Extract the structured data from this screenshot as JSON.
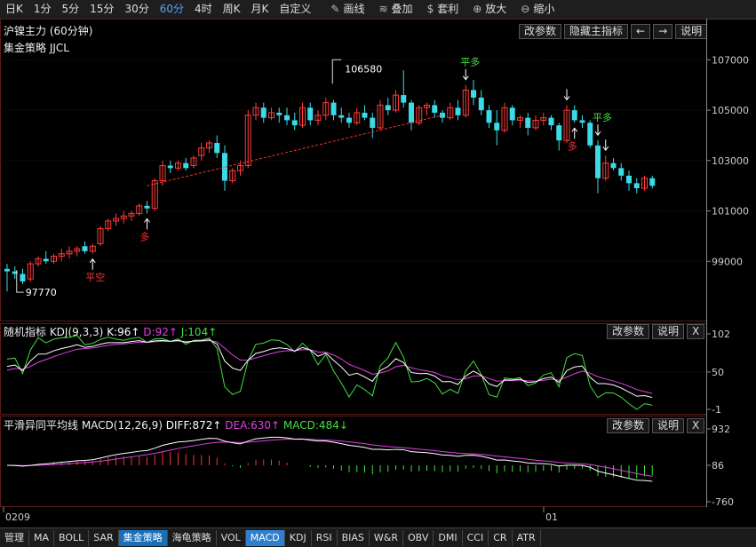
{
  "toolbar": {
    "timeframes": [
      "日K",
      "1分",
      "5分",
      "15分",
      "30分",
      "60分",
      "4时",
      "周K",
      "月K",
      "自定义"
    ],
    "active_timeframe": "60分",
    "tools": [
      {
        "label": "画线",
        "icon": "pencil-icon"
      },
      {
        "label": "叠加",
        "icon": "layers-icon"
      },
      {
        "label": "套利",
        "icon": "moneybag-icon"
      },
      {
        "label": "放大",
        "icon": "zoom-in-icon"
      },
      {
        "label": "缩小",
        "icon": "zoom-out-icon"
      }
    ]
  },
  "main_panel": {
    "title": "沪镍主力 (60分钟)",
    "strategy_label": "集金策略 JJCL",
    "buttons": {
      "params": "改参数",
      "hide": "隐藏主指标",
      "prev": "←",
      "next": "→",
      "help": "说明"
    },
    "price_axis": [
      "107000",
      "105000",
      "103000",
      "101000",
      "99000"
    ],
    "high_label": "106580",
    "low_label": "97770",
    "signals": [
      "平空",
      "多",
      "平多",
      "平多",
      "多"
    ]
  },
  "kdj_panel": {
    "title": "随机指标 KDJ(9,3,3)",
    "k": "K:96↑",
    "d": "D:92↑",
    "j": "J:104↑",
    "buttons": {
      "params": "改参数",
      "help": "说明",
      "close": "X"
    },
    "axis": [
      "102",
      "50",
      "-1"
    ],
    "colors": {
      "k": "#ffffff",
      "d": "#e040e0",
      "j": "#40e040"
    }
  },
  "macd_panel": {
    "title": "平滑异同平均线 MACD(12,26,9)",
    "diff": "DIFF:872↑",
    "dea": "DEA:630↑",
    "macd": "MACD:484↓",
    "buttons": {
      "params": "改参数",
      "help": "说明",
      "close": "X"
    },
    "axis": [
      "932",
      "86",
      "-760"
    ],
    "colors": {
      "diff": "#ffffff",
      "dea": "#e040e0",
      "macd": "#40e040"
    }
  },
  "date_axis": [
    "0209",
    "01"
  ],
  "bottom_tabs": [
    "管理",
    "MA",
    "BOLL",
    "SAR",
    "集金策略",
    "海龟策略",
    "VOL",
    "MACD",
    "KDJ",
    "RSI",
    "BIAS",
    "W&R",
    "OBV",
    "DMI",
    "CCI",
    "CR",
    "ATR"
  ],
  "selected_tabs": [
    "集金策略",
    "MACD"
  ],
  "chart_data": {
    "type": "candlestick",
    "y_range": [
      97000,
      108000
    ],
    "candles": [
      [
        98700,
        98900,
        97800,
        98600
      ],
      [
        98600,
        98800,
        98300,
        98500
      ],
      [
        98500,
        98700,
        98100,
        98200
      ],
      [
        98300,
        99000,
        98200,
        98900
      ],
      [
        98900,
        99200,
        98800,
        99100
      ],
      [
        99100,
        99400,
        98900,
        99000
      ],
      [
        99000,
        99300,
        98900,
        99200
      ],
      [
        99200,
        99500,
        99000,
        99300
      ],
      [
        99300,
        99600,
        99100,
        99400
      ],
      [
        99400,
        99600,
        99200,
        99500
      ],
      [
        99600,
        99800,
        99300,
        99400
      ],
      [
        99400,
        99700,
        99300,
        99600
      ],
      [
        99700,
        100400,
        99600,
        100300
      ],
      [
        100300,
        100700,
        100200,
        100600
      ],
      [
        100600,
        100900,
        100400,
        100700
      ],
      [
        100700,
        101000,
        100500,
        100800
      ],
      [
        100800,
        101000,
        100600,
        100900
      ],
      [
        100900,
        101300,
        100800,
        101200
      ],
      [
        101200,
        101400,
        100900,
        101100
      ],
      [
        101100,
        102300,
        101000,
        102200
      ],
      [
        102200,
        103000,
        102000,
        102800
      ],
      [
        102800,
        103000,
        102500,
        102700
      ],
      [
        102700,
        103000,
        102600,
        102900
      ],
      [
        102900,
        103100,
        102600,
        102700
      ],
      [
        102800,
        103200,
        102700,
        103100
      ],
      [
        103200,
        103700,
        103000,
        103500
      ],
      [
        103500,
        103800,
        103300,
        103700
      ],
      [
        103700,
        104000,
        103100,
        103300
      ],
      [
        103300,
        103600,
        101800,
        102200
      ],
      [
        102200,
        102700,
        102100,
        102600
      ],
      [
        102600,
        103000,
        102400,
        102800
      ],
      [
        102800,
        105000,
        102700,
        104800
      ],
      [
        104800,
        105300,
        104600,
        105100
      ],
      [
        105100,
        105300,
        104500,
        104700
      ],
      [
        104700,
        105100,
        104600,
        104900
      ],
      [
        104900,
        105100,
        104500,
        104800
      ],
      [
        104800,
        105100,
        104400,
        104600
      ],
      [
        104600,
        104900,
        104200,
        104400
      ],
      [
        104400,
        105300,
        104300,
        105100
      ],
      [
        105100,
        105300,
        104400,
        104600
      ],
      [
        104600,
        105000,
        104400,
        104800
      ],
      [
        104800,
        105500,
        104600,
        105300
      ],
      [
        105300,
        105400,
        104600,
        104800
      ],
      [
        104800,
        105100,
        104500,
        104700
      ],
      [
        104700,
        104900,
        104300,
        104500
      ],
      [
        104500,
        105100,
        104400,
        104900
      ],
      [
        104900,
        105200,
        104600,
        104700
      ],
      [
        104700,
        104900,
        103900,
        104300
      ],
      [
        104300,
        105400,
        104200,
        105200
      ],
      [
        105200,
        105500,
        104800,
        105000
      ],
      [
        105000,
        105800,
        104900,
        105600
      ],
      [
        105600,
        106580,
        105100,
        105300
      ],
      [
        105300,
        105400,
        104200,
        104500
      ],
      [
        104500,
        105200,
        104400,
        105100
      ],
      [
        105100,
        105300,
        104800,
        105200
      ],
      [
        105200,
        105400,
        104700,
        104900
      ],
      [
        104900,
        105000,
        104500,
        104700
      ],
      [
        104700,
        105300,
        104600,
        105100
      ],
      [
        105100,
        105400,
        104600,
        104800
      ],
      [
        104800,
        106000,
        104700,
        105800
      ],
      [
        105800,
        106200,
        105200,
        105500
      ],
      [
        105500,
        105800,
        104800,
        105000
      ],
      [
        105000,
        105200,
        104300,
        104500
      ],
      [
        104500,
        105000,
        103600,
        104200
      ],
      [
        104200,
        105300,
        104100,
        105100
      ],
      [
        105100,
        105200,
        104400,
        104600
      ],
      [
        104600,
        104800,
        104300,
        104700
      ],
      [
        104700,
        104900,
        104000,
        104300
      ],
      [
        104300,
        104800,
        104200,
        104600
      ],
      [
        104600,
        104900,
        104400,
        104700
      ],
      [
        104700,
        104800,
        104200,
        104400
      ],
      [
        104400,
        104500,
        103400,
        103800
      ],
      [
        103800,
        105200,
        103700,
        105000
      ],
      [
        105000,
        105200,
        104500,
        104600
      ],
      [
        104600,
        104800,
        104300,
        104500
      ],
      [
        104500,
        104600,
        103500,
        103600
      ],
      [
        103600,
        103800,
        101700,
        102300
      ],
      [
        102300,
        103200,
        102200,
        102900
      ],
      [
        102900,
        103100,
        102600,
        102700
      ],
      [
        102700,
        102900,
        102200,
        102400
      ],
      [
        102400,
        102600,
        101800,
        102100
      ],
      [
        102100,
        102300,
        101700,
        101900
      ],
      [
        101900,
        102400,
        101800,
        102300
      ],
      [
        102300,
        102400,
        101900,
        102000
      ]
    ]
  }
}
